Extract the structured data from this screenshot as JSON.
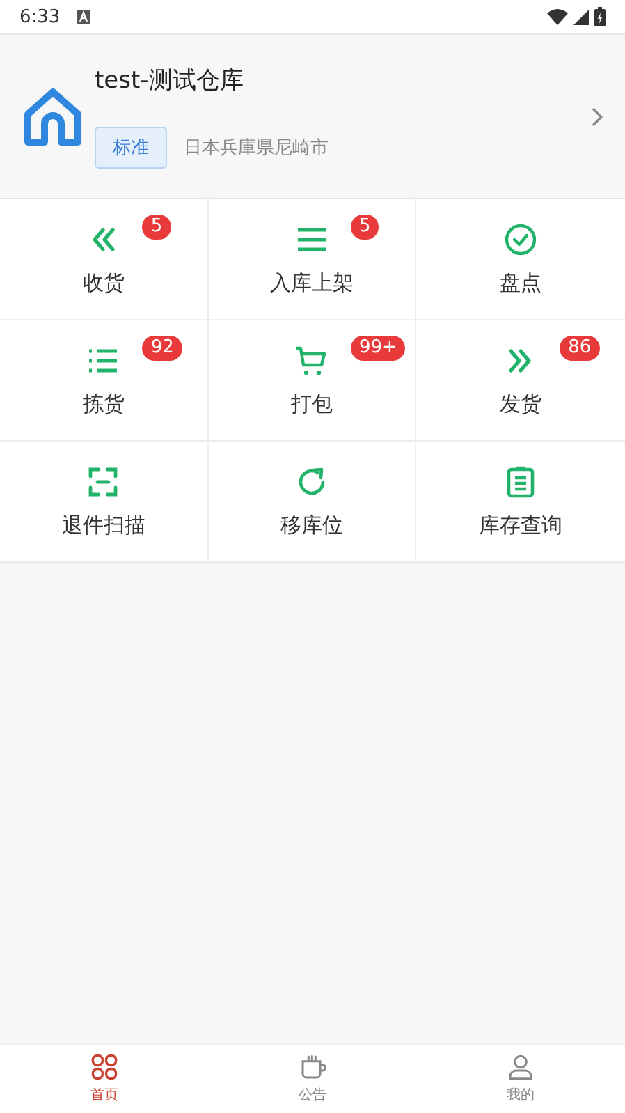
{
  "status_bar": {
    "time": "6:33"
  },
  "warehouse": {
    "name": "test-测试仓库",
    "tag": "标准",
    "address": "日本兵庫県尼崎市"
  },
  "grid": [
    {
      "label": "收货",
      "kind": "receive",
      "badge": "5"
    },
    {
      "label": "入库上架",
      "kind": "shelve",
      "badge": "5"
    },
    {
      "label": "盘点",
      "kind": "check"
    },
    {
      "label": "拣货",
      "kind": "pick",
      "badge": "92"
    },
    {
      "label": "打包",
      "kind": "pack",
      "badge": "99+"
    },
    {
      "label": "发货",
      "kind": "ship",
      "badge": "86"
    },
    {
      "label": "退件扫描",
      "kind": "scan"
    },
    {
      "label": "移库位",
      "kind": "move"
    },
    {
      "label": "库存查询",
      "kind": "stock"
    }
  ],
  "tabs": [
    {
      "label": "首页",
      "kind": "home",
      "selected": true
    },
    {
      "label": "公告",
      "kind": "notice",
      "selected": false
    },
    {
      "label": "我的",
      "kind": "me",
      "selected": false
    }
  ]
}
